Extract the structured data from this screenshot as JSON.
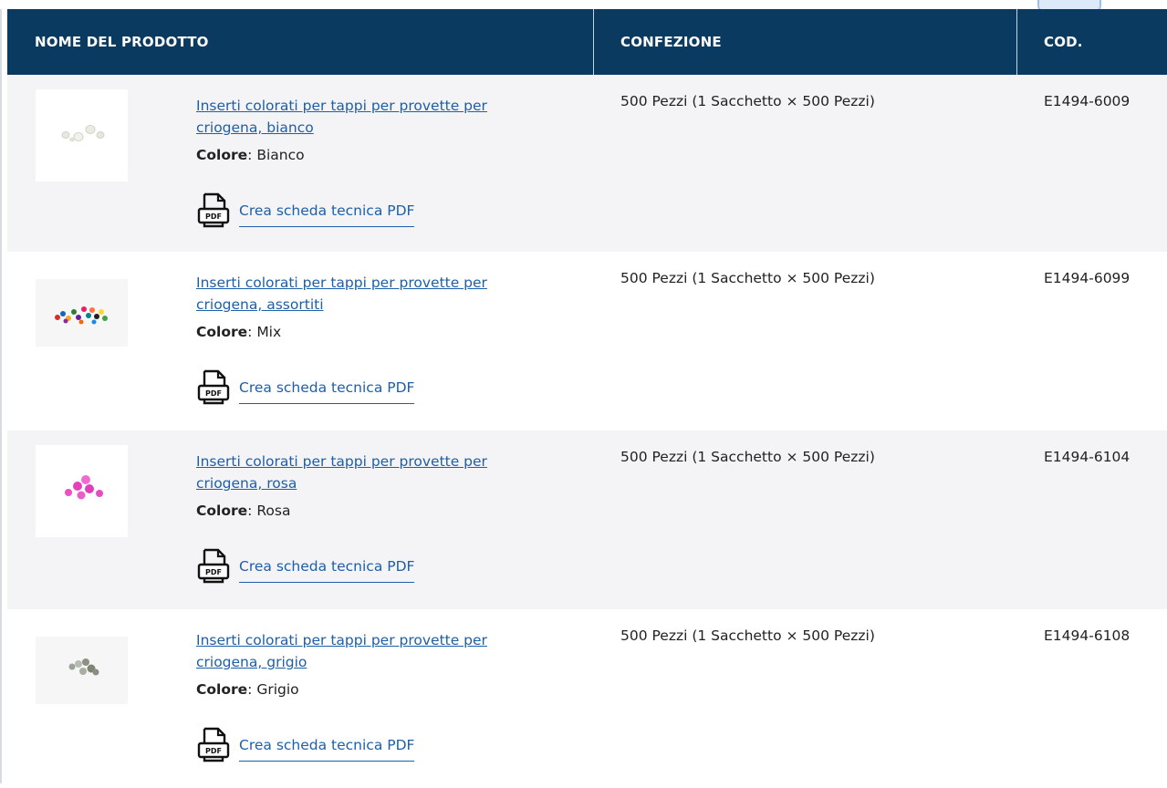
{
  "table": {
    "headers": {
      "name": "NOME DEL PRODOTTO",
      "pack": "CONFEZIONE",
      "code": "COD."
    },
    "color_label": "Colore",
    "pdf_label": "Crea scheda tecnica PDF",
    "rows": [
      {
        "name_line1": "Inserti colorati per tappi per provette per",
        "name_line2": "criogena, bianco",
        "color_value": "Bianco",
        "pack": "500 Pezzi (1 Sacchetto × 500 Pezzi)",
        "code": "E1494-6009"
      },
      {
        "name_line1": "Inserti colorati per tappi per provette per",
        "name_line2": "criogena, assortiti",
        "color_value": "Mix",
        "pack": "500 Pezzi (1 Sacchetto × 500 Pezzi)",
        "code": "E1494-6099"
      },
      {
        "name_line1": "Inserti colorati per tappi per provette per",
        "name_line2": "criogena, rosa",
        "color_value": "Rosa",
        "pack": "500 Pezzi (1 Sacchetto × 500 Pezzi)",
        "code": "E1494-6104"
      },
      {
        "name_line1": "Inserti colorati per tappi per provette per",
        "name_line2": "criogena, grigio",
        "color_value": "Grigio",
        "pack": "500 Pezzi (1 Sacchetto × 500 Pezzi)",
        "code": "E1494-6108"
      }
    ]
  },
  "colors": {
    "header_bg": "#0b3a60",
    "link": "#1d5fa8",
    "row_alt": "#f4f4f6"
  },
  "icons": {
    "pdf": "pdf-file-icon"
  }
}
